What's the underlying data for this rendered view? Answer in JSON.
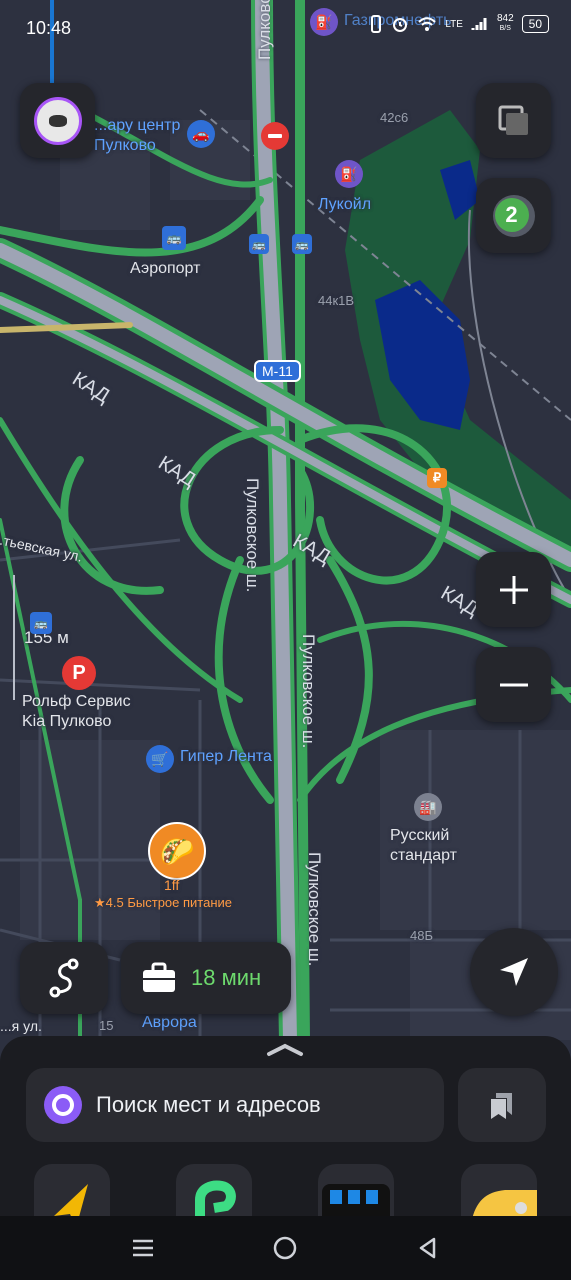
{
  "status_bar": {
    "time": "10:48",
    "speed_value": "842",
    "speed_unit": "B/S",
    "network": "LTE",
    "battery": "50"
  },
  "map": {
    "labels": {
      "airport_center": "...ару центр\nПулково",
      "airport": "Аэропорт",
      "lukoil": "Лукойл",
      "gazprom": "Газпромнефть",
      "building_42c6": "42с6",
      "building_44k1v": "44к1В",
      "kad1": "КАД",
      "kad2": "КАД",
      "kad3": "КАД",
      "kad4": "КАД",
      "pulkovskoe1": "Пулковское ш.",
      "pulkovskoe2": "Пулковское ш.",
      "pulkovskoe3": "Пулковское ш.",
      "pulkovskoe_top": "Пулковское ш.",
      "m11": "М-11",
      "street_left": "...тьевская ул.",
      "scale": "155 м",
      "rolf": "Рольф Сервис\nKia Пулково",
      "giper_lenta": "Гипер Лента",
      "russkiy_standart": "Русский\nстандарт",
      "building_48b": "48Б",
      "building_15": "15",
      "avrora": "Аврора",
      "street_bottom_left": "...я ул."
    },
    "place_card": {
      "name": "1ff",
      "rating": "★4.5",
      "category": "Быстрое питание"
    },
    "layers_badge": "2"
  },
  "route": {
    "commute_time": "18 мин"
  },
  "search": {
    "placeholder": "Поиск мест и адресов"
  },
  "colors": {
    "map_bg": "#2d3140",
    "road_green": "#3aa55b",
    "road_gray": "#9ea4b5",
    "water": "#0a2a8a",
    "accent_green": "#4caf50",
    "alice_purple": "#8b5cf6"
  }
}
